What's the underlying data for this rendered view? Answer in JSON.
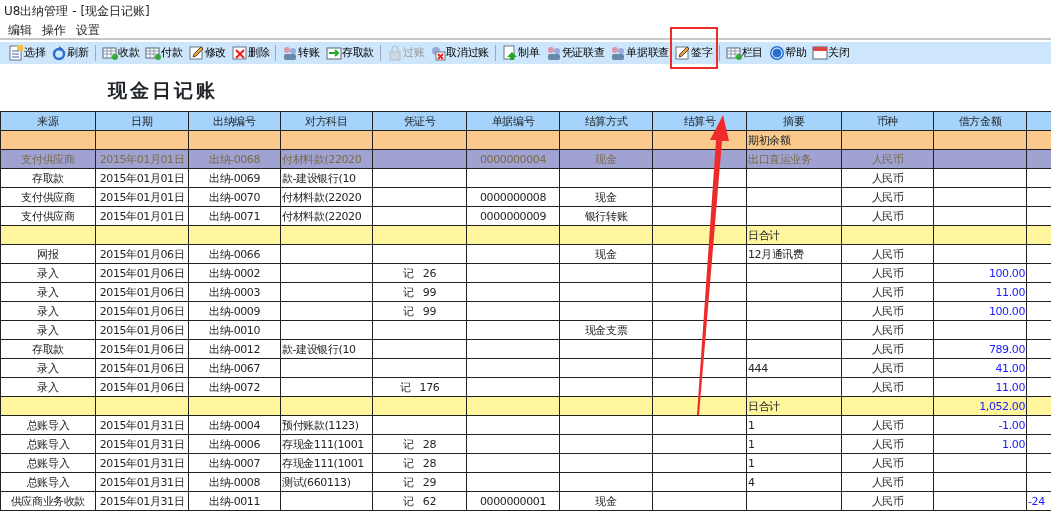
{
  "window": {
    "title": "U8出纳管理 - [现金日记账]"
  },
  "menu": [
    {
      "label": "编辑"
    },
    {
      "label": "操作"
    },
    {
      "label": "设置"
    }
  ],
  "toolbar": [
    [
      {
        "label": "选择",
        "disabled": false
      },
      {
        "label": "刷新",
        "disabled": false
      }
    ],
    [
      {
        "label": "收款",
        "disabled": false
      },
      {
        "label": "付款",
        "disabled": false
      },
      {
        "label": "修改",
        "disabled": false
      },
      {
        "label": "删除",
        "disabled": false
      }
    ],
    [
      {
        "label": "转账",
        "disabled": false
      },
      {
        "label": "存取款",
        "disabled": false
      }
    ],
    [
      {
        "label": "过账",
        "disabled": true
      },
      {
        "label": "取消过账",
        "disabled": false
      }
    ],
    [
      {
        "label": "制单",
        "disabled": false
      },
      {
        "label": "凭证联查",
        "disabled": false
      },
      {
        "label": "单据联查",
        "disabled": false
      },
      {
        "label": "签字",
        "disabled": false
      }
    ],
    [
      {
        "label": "栏目",
        "disabled": false
      },
      {
        "label": "帮助",
        "disabled": false
      },
      {
        "label": "关闭",
        "disabled": false
      }
    ]
  ],
  "report_title": "现金日记账",
  "table": {
    "columns": [
      "来源",
      "日期",
      "出纳编号",
      "对方科目",
      "凭证号",
      "单据编号",
      "结算方式",
      "结算号",
      "摘要",
      "币种",
      "借方金额"
    ],
    "rows": [
      {
        "kind": "opening",
        "selected": false,
        "cells": [
          null,
          null,
          null,
          null,
          null,
          null,
          null,
          null,
          "期初余额",
          null,
          null,
          null
        ]
      },
      {
        "kind": "entry",
        "selected": true,
        "cells": [
          "支付供应商",
          "2015年01月01日",
          "出纳-0068",
          "付材料款(22020",
          null,
          "0000000004",
          "现金",
          null,
          "出口直运业务",
          "人民币",
          null,
          null
        ]
      },
      {
        "kind": "entry",
        "selected": false,
        "cells": [
          "存取款",
          "2015年01月01日",
          "出纳-0069",
          "款-建设银行(10",
          null,
          null,
          null,
          null,
          null,
          "人民币",
          null,
          null
        ]
      },
      {
        "kind": "entry",
        "selected": false,
        "cells": [
          "支付供应商",
          "2015年01月01日",
          "出纳-0070",
          "付材料款(22020",
          null,
          "0000000008",
          "现金",
          null,
          null,
          "人民币",
          null,
          null
        ]
      },
      {
        "kind": "entry",
        "selected": false,
        "cells": [
          "支付供应商",
          "2015年01月01日",
          "出纳-0071",
          "付材料款(22020",
          null,
          "0000000009",
          "银行转账",
          null,
          null,
          "人民币",
          null,
          null
        ]
      },
      {
        "kind": "subtotal",
        "selected": false,
        "cells": [
          null,
          null,
          null,
          null,
          null,
          null,
          null,
          null,
          "日合计",
          null,
          null,
          null
        ]
      },
      {
        "kind": "entry",
        "selected": false,
        "cells": [
          "网报",
          "2015年01月06日",
          "出纳-0066",
          null,
          null,
          null,
          "现金",
          null,
          "12月通讯费",
          "人民币",
          null,
          null
        ]
      },
      {
        "kind": "entry",
        "selected": false,
        "cells": [
          "录入",
          "2015年01月06日",
          "出纳-0002",
          null,
          "记   26",
          null,
          null,
          null,
          null,
          "人民币",
          "100.00",
          null
        ]
      },
      {
        "kind": "entry",
        "selected": false,
        "cells": [
          "录入",
          "2015年01月06日",
          "出纳-0003",
          null,
          "记   99",
          null,
          null,
          null,
          null,
          "人民币",
          "11.00",
          null
        ]
      },
      {
        "kind": "entry",
        "selected": false,
        "cells": [
          "录入",
          "2015年01月06日",
          "出纳-0009",
          null,
          "记   99",
          null,
          null,
          null,
          null,
          "人民币",
          "100.00",
          null
        ]
      },
      {
        "kind": "entry",
        "selected": false,
        "cells": [
          "录入",
          "2015年01月06日",
          "出纳-0010",
          null,
          null,
          null,
          "现金支票",
          null,
          null,
          "人民币",
          null,
          null
        ]
      },
      {
        "kind": "entry",
        "selected": false,
        "cells": [
          "存取款",
          "2015年01月06日",
          "出纳-0012",
          "款-建设银行(10",
          null,
          null,
          null,
          null,
          null,
          "人民币",
          "789.00",
          null
        ]
      },
      {
        "kind": "entry",
        "selected": false,
        "cells": [
          "录入",
          "2015年01月06日",
          "出纳-0067",
          null,
          null,
          null,
          null,
          null,
          "444",
          "人民币",
          "41.00",
          null
        ]
      },
      {
        "kind": "entry",
        "selected": false,
        "cells": [
          "录入",
          "2015年01月06日",
          "出纳-0072",
          null,
          "记   176",
          null,
          null,
          null,
          null,
          "人民币",
          "11.00",
          null
        ]
      },
      {
        "kind": "subtotal",
        "selected": false,
        "cells": [
          null,
          null,
          null,
          null,
          null,
          null,
          null,
          null,
          "日合计",
          null,
          "1,052.00",
          null
        ]
      },
      {
        "kind": "entry",
        "selected": false,
        "cells": [
          "总账导入",
          "2015年01月31日",
          "出纳-0004",
          "预付账款(1123)",
          null,
          null,
          null,
          null,
          "1",
          "人民币",
          "-1.00",
          null
        ]
      },
      {
        "kind": "entry",
        "selected": false,
        "cells": [
          "总账导入",
          "2015年01月31日",
          "出纳-0006",
          "存现金111(1001",
          "记   28",
          null,
          null,
          null,
          "1",
          "人民币",
          "1.00",
          null
        ]
      },
      {
        "kind": "entry",
        "selected": false,
        "cells": [
          "总账导入",
          "2015年01月31日",
          "出纳-0007",
          "存现金111(1001",
          "记   28",
          null,
          null,
          null,
          "1",
          "人民币",
          null,
          null
        ]
      },
      {
        "kind": "entry",
        "selected": false,
        "cells": [
          "总账导入",
          "2015年01月31日",
          "出纳-0008",
          "测试(660113)",
          "记   29",
          null,
          null,
          null,
          "4",
          "人民币",
          null,
          null
        ]
      },
      {
        "kind": "entry",
        "selected": false,
        "cells": [
          "供应商业务收款",
          "2015年01月31日",
          "出纳-0011",
          null,
          "记   62",
          "0000000001",
          "现金",
          null,
          null,
          "人民币",
          null,
          "-24"
        ]
      }
    ]
  },
  "annotations": [
    {
      "kind": "box"
    },
    {
      "kind": "arrow"
    }
  ]
}
